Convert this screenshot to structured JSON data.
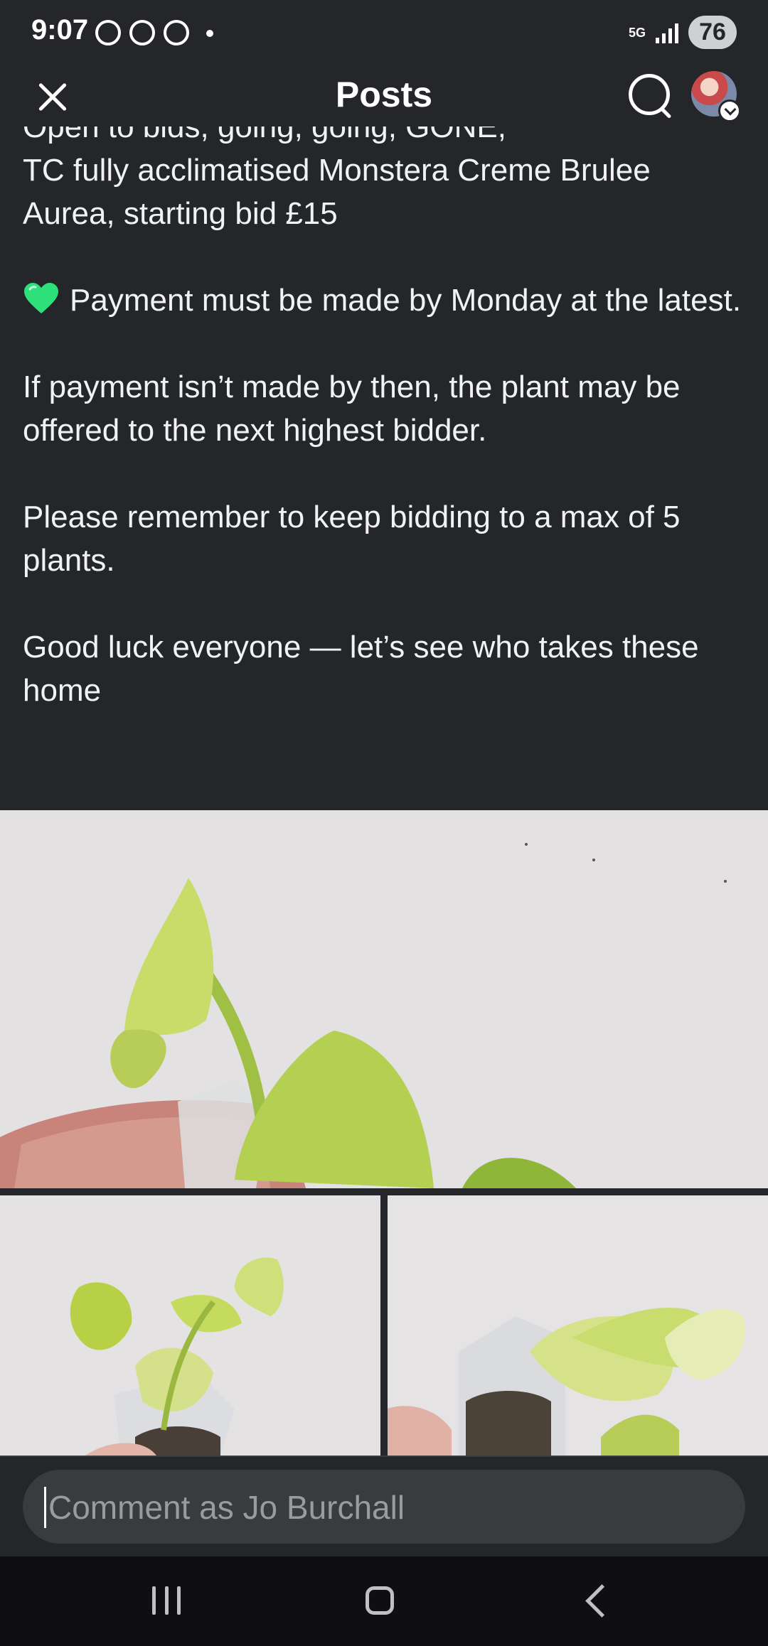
{
  "status_bar": {
    "time": "9:07",
    "network": "5G",
    "battery": "76"
  },
  "header": {
    "title": "Posts"
  },
  "post": {
    "paragraphs": [
      "Open to bids, going, going, GONE,\nTC  fully acclimatised Monstera Creme Brulee Aurea, starting bid £15",
      "Payment must be made by Monday at the latest.",
      "If payment isn’t made by then, the plant may be offered to the next highest bidder.",
      "Please remember to keep bidding to a max of 5 plants.",
      "Good luck everyone — let’s see who takes these home"
    ],
    "payment_emoji": "green-heart-icon"
  },
  "images": [
    "plant-photo-main",
    "plant-photo-left",
    "plant-photo-right"
  ],
  "comment": {
    "placeholder": "Comment as Jo Burchall"
  },
  "colors": {
    "background": "#25262a",
    "text": "#f1f2f4",
    "input_bg": "#3a3b3f",
    "heart": "#2ee07a"
  }
}
